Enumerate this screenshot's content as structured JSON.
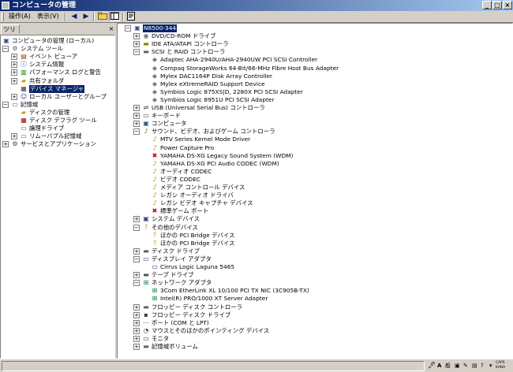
{
  "window": {
    "title": "コンピュータの管理"
  },
  "menu": {
    "action": "操作(A)",
    "view": "表示(V)"
  },
  "toolbar": {
    "icons": [
      "back-arrow-icon",
      "forward-arrow-icon",
      "folder-up-icon",
      "show-hide-tree-icon",
      "properties-icon"
    ]
  },
  "tab": {
    "tree_label": "ツリー"
  },
  "left_tree": [
    {
      "label": "コンピュータの管理 (ローカル)",
      "icon": "computer-management-icon",
      "level": 0,
      "expander": ""
    },
    {
      "label": "システム ツール",
      "icon": "tools-icon",
      "level": 1,
      "expander": "-"
    },
    {
      "label": "イベント ビューア",
      "icon": "event-viewer-icon",
      "level": 2,
      "expander": "+"
    },
    {
      "label": "システム情報",
      "icon": "system-info-icon",
      "level": 2,
      "expander": "+"
    },
    {
      "label": "パフォーマンス ログと警告",
      "icon": "performance-icon",
      "level": 2,
      "expander": "+"
    },
    {
      "label": "共有フォルダ",
      "icon": "shared-folder-icon",
      "level": 2,
      "expander": "+"
    },
    {
      "label": "デバイス マネージャ",
      "icon": "device-manager-icon",
      "level": 2,
      "expander": "",
      "selected": true
    },
    {
      "label": "ローカル ユーザーとグループ",
      "icon": "users-icon",
      "level": 2,
      "expander": "+"
    },
    {
      "label": "記憶域",
      "icon": "storage-icon",
      "level": 1,
      "expander": "-"
    },
    {
      "label": "ディスクの管理",
      "icon": "disk-management-icon",
      "level": 2,
      "expander": ""
    },
    {
      "label": "ディスク デフラグ ツール",
      "icon": "defrag-icon",
      "level": 2,
      "expander": ""
    },
    {
      "label": "論理ドライブ",
      "icon": "logical-drive-icon",
      "level": 2,
      "expander": ""
    },
    {
      "label": "リムーバブル記憶域",
      "icon": "removable-storage-icon",
      "level": 2,
      "expander": "+"
    },
    {
      "label": "サービスとアプリケーション",
      "icon": "services-icon",
      "level": 1,
      "expander": "+"
    }
  ],
  "right_tree": [
    {
      "label": "N8500-344",
      "icon": "computer-icon",
      "level": 0,
      "expander": "-",
      "selected": true
    },
    {
      "label": "DVD/CD-ROM ドライブ",
      "icon": "cdrom-icon",
      "level": 1,
      "expander": "+"
    },
    {
      "label": "IDE ATA/ATAPI コントローラ",
      "icon": "ide-controller-icon",
      "level": 1,
      "expander": "+"
    },
    {
      "label": "SCSI と RAID コントローラ",
      "icon": "scsi-controller-icon",
      "level": 1,
      "expander": "-"
    },
    {
      "label": "Adaptec AHA-2940U/AHA-2940UW PCI SCSI Controller",
      "icon": "scsi-device-icon",
      "level": 2,
      "expander": ""
    },
    {
      "label": "Compaq StorageWorks 64-Bit/66-MHz Fibre Host Bus Adapter",
      "icon": "scsi-device-icon",
      "level": 2,
      "expander": ""
    },
    {
      "label": "Mylex DAC1164P Disk Array Controller",
      "icon": "scsi-device-icon",
      "level": 2,
      "expander": ""
    },
    {
      "label": "Mylex eXtremeRAID Support Device",
      "icon": "scsi-device-icon",
      "level": 2,
      "expander": ""
    },
    {
      "label": "Symbios Logic 875XS|D, 2280X PCI SCSI Adapter",
      "icon": "scsi-device-icon",
      "level": 2,
      "expander": ""
    },
    {
      "label": "Symbios Logic 8951U PCI SCSI Adapter",
      "icon": "scsi-device-icon",
      "level": 2,
      "expander": ""
    },
    {
      "label": "USB (Universal Serial Bus) コントローラ",
      "icon": "usb-icon",
      "level": 1,
      "expander": "+"
    },
    {
      "label": "キーボード",
      "icon": "keyboard-icon",
      "level": 1,
      "expander": "+"
    },
    {
      "label": "コンピュータ",
      "icon": "computer-icon",
      "level": 1,
      "expander": "+"
    },
    {
      "label": "サウンド、ビデオ、およびゲーム コントローラ",
      "icon": "sound-icon",
      "level": 1,
      "expander": "-"
    },
    {
      "label": "MTV Series Kernel Mode Driver",
      "icon": "sound-device-icon",
      "level": 2,
      "expander": ""
    },
    {
      "label": "Power Capture Pro",
      "icon": "sound-device-icon",
      "level": 2,
      "expander": ""
    },
    {
      "label": "YAMAHA DS-XG Legacy Sound System (WDM)",
      "icon": "disabled-device-icon",
      "level": 2,
      "expander": ""
    },
    {
      "label": "YAMAHA DS-XG PCI Audio CODEC (WDM)",
      "icon": "sound-device-icon",
      "level": 2,
      "expander": ""
    },
    {
      "label": "オーディオ CODEC",
      "icon": "sound-device-icon",
      "level": 2,
      "expander": ""
    },
    {
      "label": "ビデオ CODEC",
      "icon": "sound-device-icon",
      "level": 2,
      "expander": ""
    },
    {
      "label": "メディア コントロール デバイス",
      "icon": "sound-device-icon",
      "level": 2,
      "expander": ""
    },
    {
      "label": "レガシ オーディオ ドライバ",
      "icon": "sound-device-icon",
      "level": 2,
      "expander": ""
    },
    {
      "label": "レガシ ビデオ キャプチャ デバイス",
      "icon": "sound-device-icon",
      "level": 2,
      "expander": ""
    },
    {
      "label": "標準ゲーム ポート",
      "icon": "disabled-device-icon",
      "level": 2,
      "expander": ""
    },
    {
      "label": "システム デバイス",
      "icon": "system-device-icon",
      "level": 1,
      "expander": "+"
    },
    {
      "label": "その他のデバイス",
      "icon": "unknown-device-icon",
      "level": 1,
      "expander": "-"
    },
    {
      "label": "ほかの PCI Bridge デバイス",
      "icon": "unknown-device-icon",
      "level": 2,
      "expander": ""
    },
    {
      "label": "ほかの PCI Bridge デバイス",
      "icon": "unknown-device-icon",
      "level": 2,
      "expander": ""
    },
    {
      "label": "ディスク ドライブ",
      "icon": "disk-drive-icon",
      "level": 1,
      "expander": "+"
    },
    {
      "label": "ディスプレイ アダプタ",
      "icon": "display-icon",
      "level": 1,
      "expander": "-"
    },
    {
      "label": "Cirrus Logic Laguna 5465",
      "icon": "display-icon",
      "level": 2,
      "expander": ""
    },
    {
      "label": "テープ ドライブ",
      "icon": "tape-drive-icon",
      "level": 1,
      "expander": "+"
    },
    {
      "label": "ネットワーク アダプタ",
      "icon": "network-icon",
      "level": 1,
      "expander": "-"
    },
    {
      "label": "3Com EtherLink XL 10/100 PCI TX NIC (3C905B-TX)",
      "icon": "network-icon",
      "level": 2,
      "expander": ""
    },
    {
      "label": "Intel(R) PRO/1000 XT Server Adapter",
      "icon": "network-icon",
      "level": 2,
      "expander": ""
    },
    {
      "label": "フロッピー ディスク コントローラ",
      "icon": "floppy-controller-icon",
      "level": 1,
      "expander": "+"
    },
    {
      "label": "フロッピー ディスク ドライブ",
      "icon": "floppy-icon",
      "level": 1,
      "expander": "+"
    },
    {
      "label": "ポート (COM と LPT)",
      "icon": "port-icon",
      "level": 1,
      "expander": "+"
    },
    {
      "label": "マウスとそのほかのポインティング デバイス",
      "icon": "mouse-icon",
      "level": 1,
      "expander": "+"
    },
    {
      "label": "モニタ",
      "icon": "monitor-icon",
      "level": 1,
      "expander": "+"
    },
    {
      "label": "記憶域ボリューム",
      "icon": "volume-icon",
      "level": 1,
      "expander": "+"
    }
  ],
  "tray": {
    "ime_mode": "A",
    "ime_kana": "般",
    "caps": "CAPS",
    "kana": "KANA"
  }
}
